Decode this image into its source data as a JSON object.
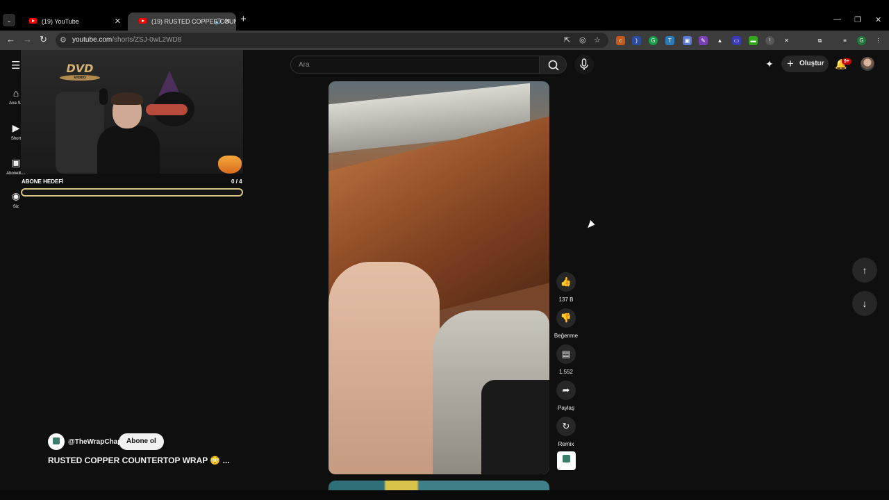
{
  "browser": {
    "tabs": [
      {
        "label": "(19) YouTube"
      },
      {
        "label": "(19) RUSTED COPPER COUN"
      }
    ],
    "url_host": "youtube.com",
    "url_path": "/shorts/ZSJ-0wL2WD8"
  },
  "youtube": {
    "search_placeholder": "Ara",
    "create_label": "Oluştur",
    "notifications_badge": "9+",
    "guide": [
      {
        "label": "Ana Sa",
        "icon": "home-icon"
      },
      {
        "label": "Short",
        "icon": "shorts-icon"
      },
      {
        "label": "Abonelikle",
        "icon": "subscriptions-icon"
      },
      {
        "label": "Siz",
        "icon": "you-icon"
      }
    ]
  },
  "actions": {
    "likes": "137 B",
    "dislike_label": "Beğenme",
    "comments": "1.552",
    "share_label": "Paylaş",
    "remix_label": "Remix"
  },
  "short": {
    "channel": "@TheWrapChap",
    "subscribe_label": "Abone ol",
    "title": "RUSTED COPPER COUNTERTOP WRAP 😳 ..."
  },
  "overlay": {
    "logo_text": "DVD",
    "logo_sub": "VIDEO",
    "goal_label": "ABONE HEDEFİ",
    "goal_count": "0 / 4",
    "goal_progress": 0
  },
  "colors": {
    "youtube_red": "#ff0000",
    "background": "#0f0f0f",
    "goal_gold": "#d8c383"
  }
}
